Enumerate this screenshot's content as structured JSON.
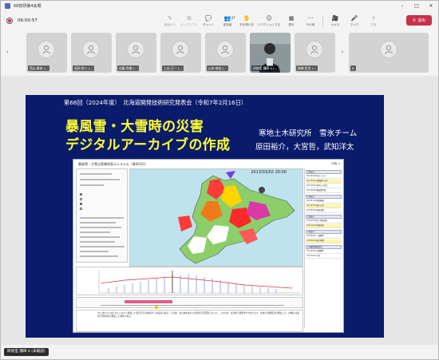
{
  "window": {
    "title": "68技研第4会場"
  },
  "toolbar": {
    "timer": "06:50:57",
    "tools": [
      {
        "icon": "pen-icon",
        "glyph": "✎",
        "label": "動画オン",
        "dim": true
      },
      {
        "icon": "popout-icon",
        "glyph": "⧉",
        "label": "ポップアウト",
        "dim": true
      },
      {
        "icon": "chat-icon",
        "glyph": "💬",
        "label": "チャット",
        "dim": false
      },
      {
        "icon": "people-icon",
        "glyph": "👥",
        "label": "参加者",
        "dim": false,
        "badge": "37"
      },
      {
        "icon": "raise-hand-icon",
        "glyph": "✋",
        "label": "手を挙げる",
        "dim": false
      },
      {
        "icon": "reaction-icon",
        "glyph": "☺",
        "label": "リアクションする",
        "dim": false
      },
      {
        "icon": "view-icon",
        "glyph": "▦",
        "label": "表示",
        "dim": false
      },
      {
        "icon": "more-icon",
        "glyph": "···",
        "label": "その他",
        "dim": false
      },
      {
        "icon": "camera-icon",
        "glyph": "🎥",
        "label": "カメラ",
        "dim": false
      },
      {
        "icon": "mic-icon",
        "glyph": "🎤",
        "label": "マイク",
        "dim": false
      },
      {
        "icon": "share-icon",
        "glyph": "⇪",
        "label": "共有",
        "dim": true
      }
    ],
    "leave_label": "退出"
  },
  "participants": [
    {
      "name": "西山 章彦 (...",
      "type": "avatar"
    },
    {
      "name": "長岡 崇人 (...",
      "type": "avatar"
    },
    {
      "name": "佐藤 貴樹 (...",
      "type": "avatar"
    },
    {
      "name": "上出 正一 (...",
      "type": "avatar"
    },
    {
      "name": "山本 恭宏 (...",
      "type": "avatar"
    },
    {
      "name": "研修室 講師 4 (...",
      "type": "video"
    },
    {
      "name": "高橋 哲生 (...",
      "type": "avatar"
    }
  ],
  "participants_overflow": "K",
  "slide": {
    "header": "第68回（2024年度）　北海道開発技術研究発表会（令和7年2月16日）",
    "title_line1": "暴風雪・大雪時の災害",
    "title_line2": "デジタルアーカイブの作成",
    "organization": "寒地土木研究所　雪氷チーム",
    "authors": "原田裕介，大宮哲，武知洋太",
    "system": {
      "title": "暴風雪・大雪災害事例表示システム（事例161）",
      "right_head": "凡例 ×",
      "date": "2013/03/02 20:00",
      "panel_items": [
        {
          "text": "[ 仮面 ]",
          "head": true
        },
        {
          "text": "3/2 16:00 峠のリスク"
        },
        {
          "text": "3/2 18:00 道路通行止め",
          "yellow": true
        },
        {
          "text": "3/2 19:00 車両立ち往生"
        },
        {
          "text": "3/2 20:00 暴風雪警報"
        },
        {
          "text": "[ 仮面 ]",
          "head": true
        },
        {
          "text": "3/2 21:00 視程障害"
        },
        {
          "text": "3/2 22:00 通行止め",
          "yellow": true
        },
        {
          "text": "3/3 00:00 救助活動"
        },
        {
          "text": "[ 仮面 ]",
          "head": true
        },
        {
          "text": "3/3 02:00 死亡事故発生"
        },
        {
          "text": "3/3 04:00 除雪作業",
          "yellow": true
        },
        {
          "text": "[ 仮面 ]",
          "head": true
        },
        {
          "text": "3/3 06:00 一部解除"
        },
        {
          "text": "3/3 08:00 通行再開",
          "yellow": true
        },
        {
          "text": "[ 道路情報提供 ]",
          "head": true
        },
        {
          "text": "3/3 10:00 全線解除"
        },
        {
          "text": "3/3 12:00 平常"
        }
      ],
      "description": "3/1 (金) から2日 (土) にかけて発達した低気圧が日本海から北海道に進み、その後、北日本を中心に冬型の気圧配置となった。このため、北日本で暴風雪や大雪となり、各地で交通障害が発生した。(中略) 北海道で死者9名が発生した事例である。"
    }
  },
  "bottom": {
    "label": "研修室 講師 4 (未確認)"
  }
}
